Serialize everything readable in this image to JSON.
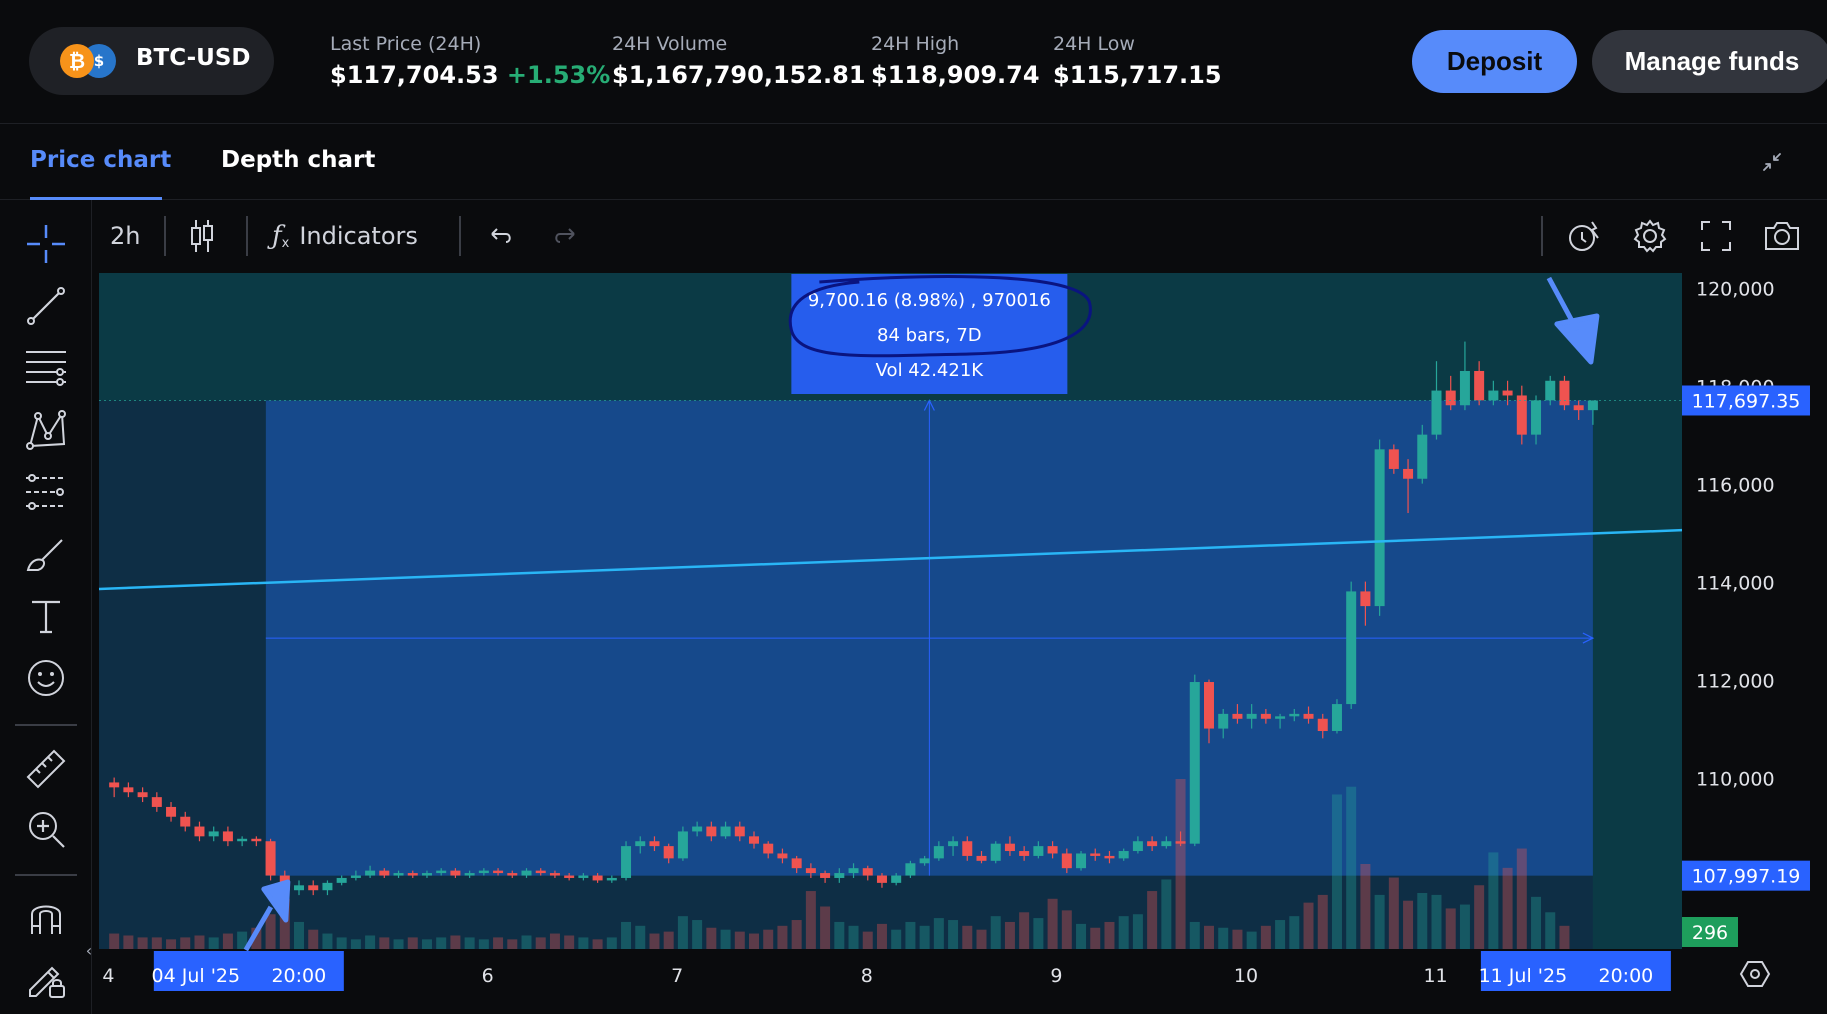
{
  "header": {
    "pair": "BTC-USD",
    "coin_btc_symbol": "₿",
    "coin_usd_symbol": "$",
    "stats": [
      {
        "label": "Last Price (24H)",
        "value": "$117,704.53",
        "change": "+1.53%"
      },
      {
        "label": "24H Volume",
        "value": "$1,167,790,152.81"
      },
      {
        "label": "24H High",
        "value": "$118,909.74"
      },
      {
        "label": "24H Low",
        "value": "$115,717.15"
      }
    ],
    "deposit_label": "Deposit",
    "manage_funds_label": "Manage funds"
  },
  "tabs": {
    "price_chart": "Price chart",
    "depth_chart": "Depth chart",
    "active": "price_chart"
  },
  "toolbar": {
    "interval": "2h",
    "indicators_label": "Indicators"
  },
  "left_tools": [
    "crosshair-icon",
    "trend-line-icon",
    "fib-retracement-icon",
    "pattern-icon",
    "prediction-icon",
    "brush-icon",
    "text-icon",
    "emoji-icon",
    "ruler-icon",
    "zoom-in-icon",
    "magnet-icon",
    "lock-drawings-icon"
  ],
  "right_tools": [
    "alert-icon",
    "settings-icon",
    "fullscreen-icon",
    "screenshot-icon"
  ],
  "colors": {
    "accent": "#578bfa",
    "up": "#26a69a",
    "down": "#ef5350",
    "trend_line": "#29b6f6",
    "measure_box": "#2962ff"
  },
  "chart_data": {
    "type": "candlestick",
    "interval": "2h",
    "y_axis_ticks": [
      "120,000",
      "118,000",
      "116,000",
      "114,000",
      "112,000",
      "110,000"
    ],
    "y_tick_values": [
      120000,
      118000,
      116000,
      114000,
      112000,
      110000
    ],
    "ylim": [
      106500,
      120300
    ],
    "x_axis_ticks": [
      "4",
      "6",
      "7",
      "8",
      "9",
      "10",
      "11"
    ],
    "x_tick_days": [
      4,
      6,
      7,
      8,
      9,
      10,
      11
    ],
    "xlim_days": [
      3.95,
      12.3
    ],
    "price_labels": {
      "last_price": "117,697.35",
      "range_low": "107,997.19",
      "volume": "296"
    },
    "measure": {
      "line1": "9,700.16 (8.98%) , 970016",
      "line2": "84 bars, 7D",
      "line3": "Vol 42.421K",
      "start_label": "04 Jul '25",
      "start_time": "20:00",
      "end_label": "11 Jul '25",
      "end_time": "20:00",
      "start_day": 4.83,
      "end_day": 11.83,
      "low": 107997.19,
      "high": 117697.35
    },
    "trend_line": {
      "start_day": 3.95,
      "start_price": 113850,
      "end_day": 12.3,
      "end_price": 115050
    },
    "candles": [
      [
        109900,
        110000,
        109600,
        109800
      ],
      [
        109800,
        109900,
        109600,
        109700
      ],
      [
        109700,
        109800,
        109500,
        109600
      ],
      [
        109600,
        109700,
        109300,
        109400
      ],
      [
        109400,
        109500,
        109100,
        109200
      ],
      [
        109200,
        109300,
        108900,
        109000
      ],
      [
        109000,
        109100,
        108700,
        108800
      ],
      [
        108800,
        109000,
        108700,
        108900
      ],
      [
        108900,
        109000,
        108600,
        108700
      ],
      [
        108700,
        108800,
        108600,
        108750
      ],
      [
        108750,
        108800,
        108600,
        108700
      ],
      [
        108700,
        108750,
        107900,
        108000
      ],
      [
        108000,
        108100,
        107600,
        107700
      ],
      [
        107700,
        107900,
        107600,
        107800
      ],
      [
        107800,
        107900,
        107600,
        107700
      ],
      [
        107700,
        107900,
        107600,
        107850
      ],
      [
        107850,
        108000,
        107800,
        107950
      ],
      [
        107950,
        108100,
        107900,
        108000
      ],
      [
        108000,
        108200,
        107950,
        108100
      ],
      [
        108100,
        108150,
        107950,
        108000
      ],
      [
        108000,
        108100,
        107950,
        108050
      ],
      [
        108050,
        108100,
        107950,
        108000
      ],
      [
        108000,
        108100,
        107950,
        108050
      ],
      [
        108050,
        108150,
        108000,
        108100
      ],
      [
        108100,
        108150,
        107950,
        108000
      ],
      [
        108000,
        108100,
        107950,
        108050
      ],
      [
        108050,
        108150,
        108000,
        108100
      ],
      [
        108100,
        108150,
        108000,
        108050
      ],
      [
        108050,
        108100,
        107950,
        108000
      ],
      [
        108000,
        108150,
        107950,
        108100
      ],
      [
        108100,
        108150,
        108000,
        108050
      ],
      [
        108050,
        108100,
        107950,
        108000
      ],
      [
        108000,
        108050,
        107900,
        107950
      ],
      [
        107950,
        108050,
        107900,
        108000
      ],
      [
        108000,
        108050,
        107850,
        107900
      ],
      [
        107900,
        108000,
        107850,
        107950
      ],
      [
        107950,
        108700,
        107900,
        108600
      ],
      [
        108600,
        108800,
        108450,
        108700
      ],
      [
        108700,
        108800,
        108500,
        108600
      ],
      [
        108600,
        108650,
        108250,
        108350
      ],
      [
        108350,
        109000,
        108300,
        108900
      ],
      [
        108900,
        109100,
        108800,
        109000
      ],
      [
        109000,
        109100,
        108700,
        108800
      ],
      [
        108800,
        109100,
        108750,
        109000
      ],
      [
        109000,
        109100,
        108700,
        108800
      ],
      [
        108800,
        108900,
        108550,
        108650
      ],
      [
        108650,
        108700,
        108350,
        108450
      ],
      [
        108450,
        108550,
        108250,
        108350
      ],
      [
        108350,
        108400,
        108050,
        108150
      ],
      [
        108150,
        108250,
        107950,
        108050
      ],
      [
        108050,
        108100,
        107850,
        107950
      ],
      [
        107950,
        108150,
        107850,
        108050
      ],
      [
        108050,
        108250,
        107950,
        108150
      ],
      [
        108150,
        108200,
        107900,
        108000
      ],
      [
        108000,
        108050,
        107750,
        107850
      ],
      [
        107850,
        108050,
        107800,
        108000
      ],
      [
        108000,
        108300,
        107950,
        108250
      ],
      [
        108250,
        108400,
        108200,
        108350
      ],
      [
        108350,
        108700,
        108300,
        108600
      ],
      [
        108600,
        108800,
        108400,
        108700
      ],
      [
        108700,
        108800,
        108300,
        108400
      ],
      [
        108400,
        108500,
        108250,
        108300
      ],
      [
        108300,
        108700,
        108250,
        108650
      ],
      [
        108650,
        108800,
        108400,
        108500
      ],
      [
        108500,
        108600,
        108300,
        108400
      ],
      [
        108400,
        108700,
        108350,
        108600
      ],
      [
        108600,
        108700,
        108350,
        108450
      ],
      [
        108450,
        108550,
        108050,
        108150
      ],
      [
        108150,
        108500,
        108100,
        108450
      ],
      [
        108450,
        108550,
        108300,
        108400
      ],
      [
        108400,
        108500,
        108250,
        108350
      ],
      [
        108350,
        108550,
        108300,
        108500
      ],
      [
        108500,
        108800,
        108450,
        108700
      ],
      [
        108700,
        108800,
        108500,
        108600
      ],
      [
        108600,
        108800,
        108550,
        108700
      ],
      [
        108700,
        108900,
        108600,
        108650
      ],
      [
        108650,
        112100,
        108600,
        111950
      ],
      [
        111950,
        112000,
        110700,
        111000
      ],
      [
        111000,
        111400,
        110800,
        111300
      ],
      [
        111300,
        111500,
        111100,
        111200
      ],
      [
        111200,
        111500,
        111000,
        111300
      ],
      [
        111300,
        111400,
        111100,
        111200
      ],
      [
        111200,
        111300,
        111000,
        111250
      ],
      [
        111250,
        111400,
        111150,
        111300
      ],
      [
        111300,
        111450,
        111100,
        111200
      ],
      [
        111200,
        111300,
        110800,
        110950
      ],
      [
        110950,
        111600,
        110900,
        111500
      ],
      [
        111500,
        114000,
        111400,
        113800
      ],
      [
        113800,
        114000,
        113100,
        113500
      ],
      [
        113500,
        116900,
        113300,
        116700
      ],
      [
        116700,
        116800,
        116200,
        116300
      ],
      [
        116300,
        116500,
        115400,
        116100
      ],
      [
        116100,
        117200,
        116000,
        117000
      ],
      [
        117000,
        118500,
        116900,
        117900
      ],
      [
        117900,
        118200,
        117500,
        117600
      ],
      [
        117600,
        118900,
        117500,
        118300
      ],
      [
        118300,
        118500,
        117600,
        117700
      ],
      [
        117700,
        118100,
        117600,
        117900
      ],
      [
        117900,
        118100,
        117600,
        117800
      ],
      [
        117800,
        118000,
        116800,
        117000
      ],
      [
        117000,
        117800,
        116800,
        117700
      ],
      [
        117700,
        118200,
        117600,
        118100
      ],
      [
        118100,
        118200,
        117500,
        117600
      ],
      [
        117600,
        117700,
        117300,
        117500
      ],
      [
        117500,
        117700,
        117200,
        117697
      ]
    ],
    "volumes": [
      8,
      7,
      6,
      6,
      5,
      6,
      7,
      6,
      8,
      9,
      11,
      18,
      26,
      14,
      10,
      8,
      6,
      5,
      7,
      6,
      5,
      6,
      5,
      6,
      7,
      6,
      5,
      6,
      5,
      7,
      6,
      8,
      7,
      6,
      5,
      6,
      14,
      12,
      8,
      9,
      17,
      15,
      11,
      10,
      9,
      8,
      10,
      12,
      15,
      30,
      22,
      14,
      12,
      9,
      13,
      10,
      14,
      12,
      16,
      15,
      12,
      10,
      17,
      14,
      19,
      16,
      26,
      20,
      13,
      11,
      14,
      17,
      18,
      30,
      36,
      88,
      14,
      12,
      11,
      10,
      9,
      12,
      15,
      17,
      24,
      28,
      80,
      84,
      44,
      28,
      37,
      25,
      29,
      28,
      21,
      23,
      33,
      50,
      42,
      52,
      27,
      19,
      12
    ]
  }
}
